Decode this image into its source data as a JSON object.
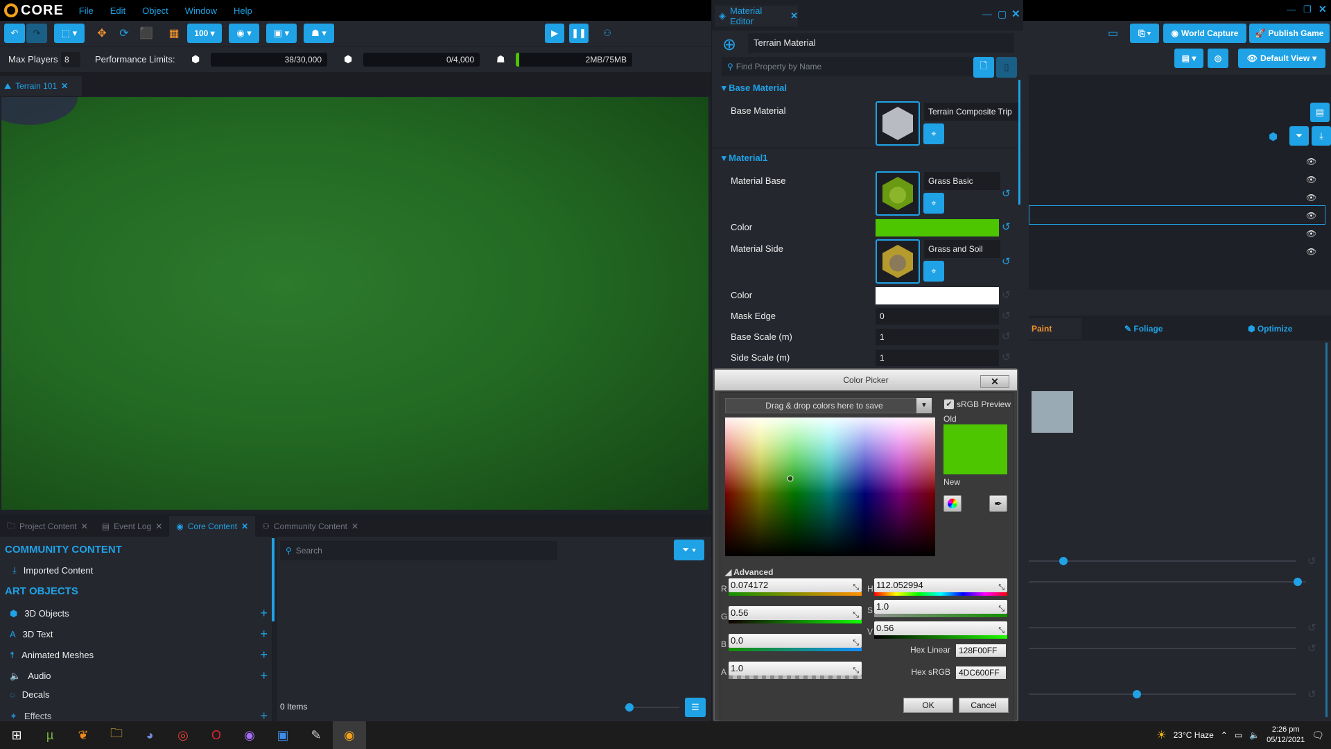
{
  "app": {
    "name": "CORE",
    "menu": [
      "File",
      "Edit",
      "Object",
      "Window",
      "Help"
    ]
  },
  "toolbar": {
    "snap_value": "100",
    "right_buttons": {
      "world_capture": "World Capture",
      "publish_game": "Publish Game",
      "default_view": "Default View"
    }
  },
  "perf": {
    "max_players_label": "Max Players",
    "max_players_value": "8",
    "limits_label": "Performance Limits:",
    "objects": "38/30,000",
    "networked": "0/4,000",
    "memory": "2MB/75MB",
    "memory_fraction": 0.027
  },
  "doc_tab": {
    "label": "Terrain 101"
  },
  "bottom": {
    "tabs": [
      {
        "label": "Project Content",
        "active": false
      },
      {
        "label": "Event Log",
        "active": false
      },
      {
        "label": "Core Content",
        "active": true
      },
      {
        "label": "Community Content",
        "active": false
      }
    ],
    "sections": {
      "community": "COMMUNITY CONTENT",
      "imported": "Imported Content",
      "art": "ART OBJECTS"
    },
    "categories": [
      "3D Objects",
      "3D Text",
      "Animated Meshes",
      "Audio",
      "Decals",
      "Effects"
    ],
    "search_placeholder": "Search",
    "items_count": "0 Items"
  },
  "material_editor": {
    "tab_label": "Material Editor",
    "material_name": "Terrain Material",
    "search_placeholder": "Find Property by Name",
    "sections": {
      "base": "Base Material",
      "material1": "Material1"
    },
    "base_material": {
      "label": "Base Material",
      "asset": "Terrain Composite Trip"
    },
    "material_base": {
      "label": "Material Base",
      "asset": "Grass Basic"
    },
    "color1": {
      "label": "Color",
      "hex": "#4dc600"
    },
    "material_side": {
      "label": "Material Side",
      "asset": "Grass and Soil"
    },
    "color2": {
      "label": "Color",
      "hex": "#ffffff"
    },
    "mask_edge": {
      "label": "Mask Edge",
      "value": "0"
    },
    "base_scale": {
      "label": "Base Scale (m)",
      "value": "1"
    },
    "side_scale": {
      "label": "Side Scale (m)",
      "value": "1"
    }
  },
  "color_picker": {
    "title": "Color Picker",
    "swatch_hint": "Drag & drop colors here to save",
    "srgb_preview": "sRGB Preview",
    "srgb_checked": true,
    "old_label": "Old",
    "new_label": "New",
    "old_color": "#4dc600",
    "new_color": "#4dc600",
    "advanced_label": "Advanced",
    "R": "0.074172",
    "G": "0.56",
    "B": "0.0",
    "A": "1.0",
    "H": "112.052994",
    "S": "1.0",
    "V": "0.56",
    "hex_linear_label": "Hex Linear",
    "hex_linear": "128F00FF",
    "hex_srgb_label": "Hex sRGB",
    "hex_srgb": "4DC600FF",
    "ok": "OK",
    "cancel": "Cancel"
  },
  "right_panel": {
    "tabs": {
      "paint": "Paint",
      "foliage": "Foliage",
      "optimize": "Optimize"
    }
  },
  "taskbar": {
    "weather": "23°C  Haze",
    "time": "2:26 pm",
    "date": "05/12/2021"
  }
}
